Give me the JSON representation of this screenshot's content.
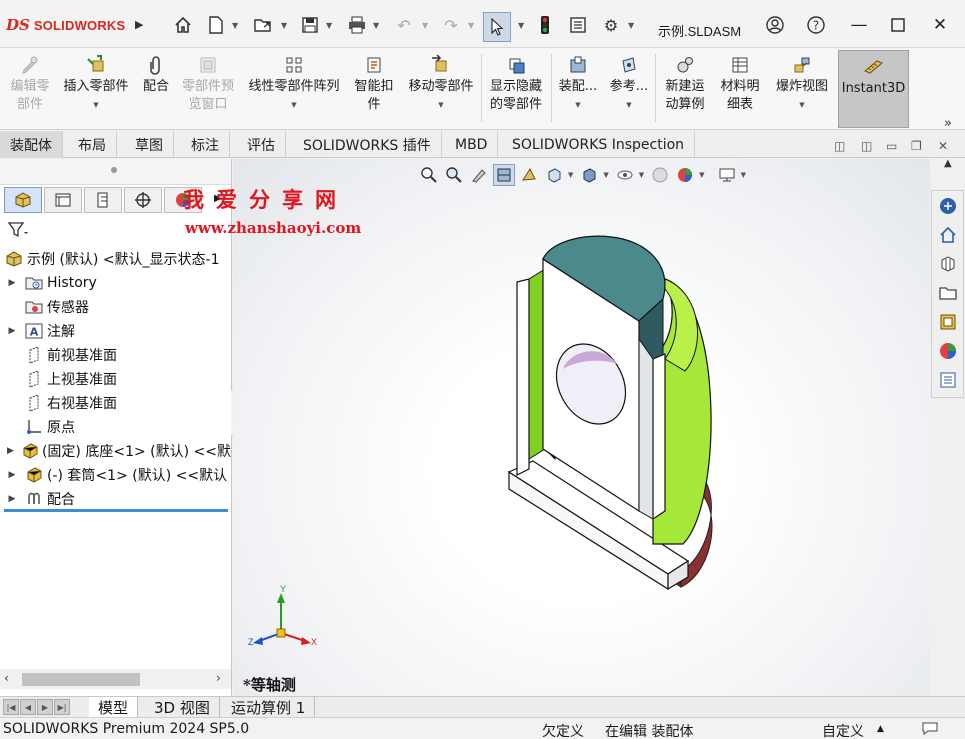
{
  "app": {
    "logo_mark": "DS",
    "logo_text": "SOLIDWORKS",
    "document_title": "示例.SLDASM"
  },
  "titlebar": {
    "icons": [
      "home-icon",
      "new-document-icon",
      "open-folder-icon",
      "save-icon",
      "print-icon",
      "undo-icon",
      "redo-icon",
      "select-arrow-icon",
      "traffic-light-icon",
      "file-properties-icon",
      "options-gear-icon",
      "account-icon",
      "help-icon",
      "minimize-icon",
      "maximize-icon",
      "close-icon"
    ]
  },
  "command_manager": {
    "items": [
      {
        "label": "编辑零\n部件",
        "enabled": false,
        "icon": "edit-component-icon"
      },
      {
        "label": "插入零部件",
        "enabled": true,
        "icon": "insert-component-icon"
      },
      {
        "label": "配合",
        "enabled": true,
        "icon": "mate-paperclip-icon"
      },
      {
        "label": "零部件预\n览窗口",
        "enabled": false,
        "icon": "component-preview-icon"
      },
      {
        "label": "线性零部件阵列",
        "enabled": true,
        "icon": "linear-pattern-icon"
      },
      {
        "label": "智能扣\n件",
        "enabled": true,
        "icon": "smart-fasteners-icon"
      },
      {
        "label": "移动零部件",
        "enabled": true,
        "icon": "move-component-icon"
      },
      {
        "label": "显示隐藏\n的零部件",
        "enabled": true,
        "icon": "show-hidden-icon"
      },
      {
        "label": "装配...",
        "enabled": true,
        "icon": "assembly-features-icon"
      },
      {
        "label": "参考...",
        "enabled": true,
        "icon": "reference-geometry-icon"
      },
      {
        "label": "新建运\n动算例",
        "enabled": true,
        "icon": "new-motion-study-icon"
      },
      {
        "label": "材料明\n细表",
        "enabled": true,
        "icon": "bill-of-materials-icon"
      },
      {
        "label": "爆炸视图",
        "enabled": true,
        "icon": "exploded-view-icon"
      }
    ],
    "instant3d_label": "Instant3D",
    "more_glyph": "»"
  },
  "tabs": [
    "装配体",
    "布局",
    "草图",
    "标注",
    "评估",
    "SOLIDWORKS 插件",
    "MBD",
    "SOLIDWORKS Inspection"
  ],
  "active_tab": "装配体",
  "feature_tree": {
    "root": "示例 (默认) <默认_显示状态-1",
    "items": [
      {
        "label": "History",
        "expandable": true,
        "icon": "history-folder-icon"
      },
      {
        "label": "传感器",
        "expandable": false,
        "icon": "sensor-icon"
      },
      {
        "label": "注解",
        "expandable": true,
        "icon": "annotation-icon"
      },
      {
        "label": "前视基准面",
        "expandable": false,
        "icon": "plane-icon"
      },
      {
        "label": "上视基准面",
        "expandable": false,
        "icon": "plane-icon"
      },
      {
        "label": "右视基准面",
        "expandable": false,
        "icon": "plane-icon"
      },
      {
        "label": "原点",
        "expandable": false,
        "icon": "origin-icon"
      },
      {
        "label": "(固定) 底座<1> (默认) <<默",
        "expandable": true,
        "icon": "part-icon"
      },
      {
        "label": "(-) 套筒<1> (默认) <<默认",
        "expandable": true,
        "icon": "part-icon"
      },
      {
        "label": "配合",
        "expandable": true,
        "icon": "mates-folder-icon"
      }
    ]
  },
  "watermark": {
    "chinese": "我爱分享网",
    "url": "www.zhanshaoyi.com"
  },
  "viewport": {
    "view_name": "*等轴测",
    "triad": {
      "x": "X",
      "y": "Y",
      "z": "Z"
    }
  },
  "bottom_tabs": [
    "模型",
    "3D 视图",
    "运动算例 1"
  ],
  "active_bottom_tab": "模型",
  "status": {
    "product": "SOLIDWORKS Premium 2024 SP5.0",
    "definition": "欠定义",
    "editing": "在编辑 装配体",
    "units": "自定义"
  },
  "colors": {
    "brand_red": "#da291c",
    "watermark_red": "#e2141d",
    "base_top": "#4a8a8c",
    "sleeve_green": "#a5e838",
    "sleeve_base": "#7a2a2a"
  }
}
